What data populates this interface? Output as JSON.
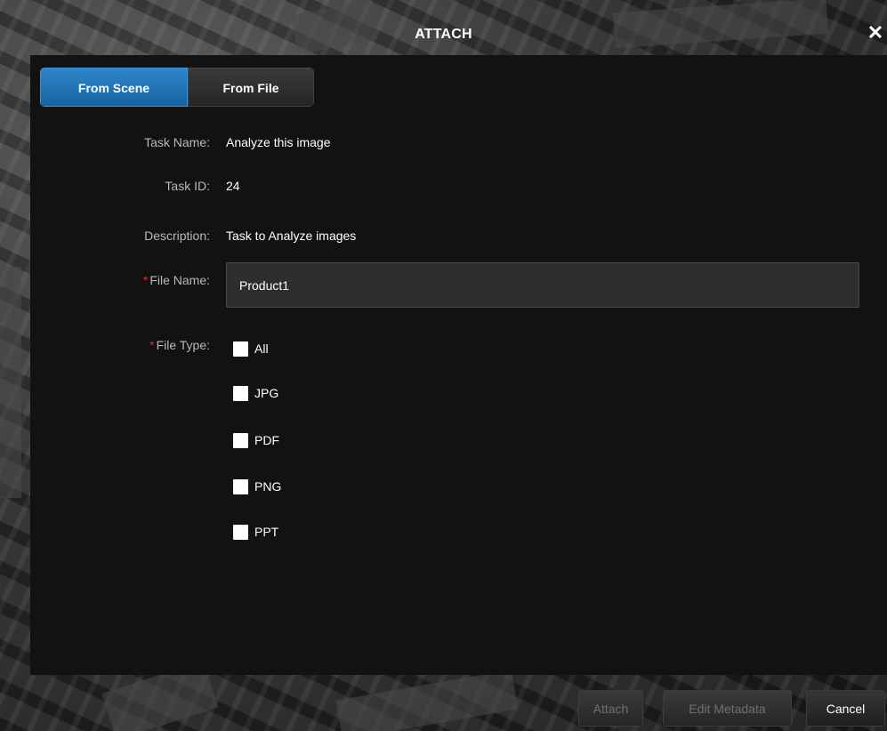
{
  "dialog": {
    "title": "ATTACH",
    "close_glyph": "✕"
  },
  "tabs": [
    {
      "label": "From Scene",
      "active": true
    },
    {
      "label": "From File",
      "active": false
    }
  ],
  "form": {
    "task_name_label": "Task Name:",
    "task_name_value": "Analyze this image",
    "task_id_label": "Task ID:",
    "task_id_value": "24",
    "description_label": "Description:",
    "description_value": "Task to Analyze images",
    "required_marker": "*",
    "file_name_label": "File Name:",
    "file_name_value": "Product1",
    "file_type_label": "File Type:",
    "file_types": [
      {
        "label": "All",
        "checked": false
      },
      {
        "label": "JPG",
        "checked": false
      },
      {
        "label": "PDF",
        "checked": false
      },
      {
        "label": "PNG",
        "checked": false
      },
      {
        "label": "PPT",
        "checked": false
      }
    ]
  },
  "footer": {
    "attach_label": "Attach",
    "edit_metadata_label": "Edit Metadata",
    "cancel_label": "Cancel"
  },
  "colors": {
    "accent": "#1f74b8",
    "required": "#d9342b",
    "dialog_bg": "#121212"
  }
}
